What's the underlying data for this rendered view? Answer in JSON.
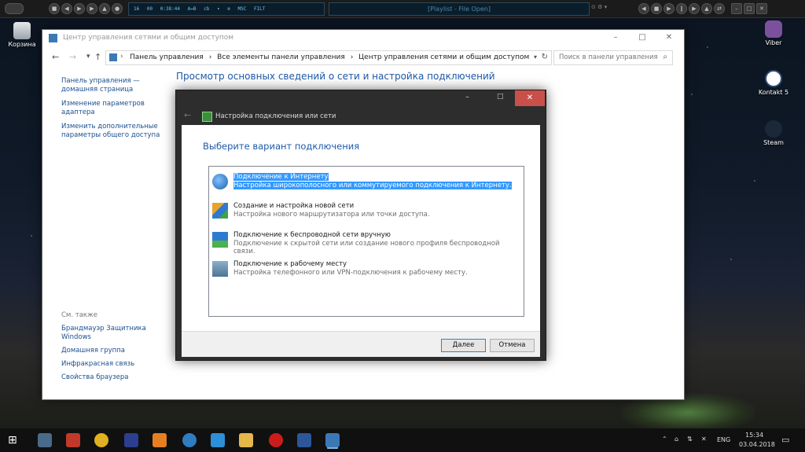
{
  "player": {
    "lcd": [
      "16",
      "00",
      "0:38:44",
      "A↔B",
      "cb",
      "▾",
      "⊕",
      "MSC",
      "FILT"
    ],
    "title": "[Playlist - File Open]"
  },
  "desktop": {
    "icons": [
      {
        "label": "Корзина"
      },
      {
        "label": "Viber"
      },
      {
        "label": "Kontakt 5"
      },
      {
        "label": "Steam"
      }
    ]
  },
  "window": {
    "title": "Центр управления сетями и общим доступом",
    "breadcrumbs": [
      "Панель управления",
      "›",
      "Все элементы панели управления",
      "›",
      "Центр управления сетями и общим доступом"
    ],
    "search_placeholder": "Поиск в панели управления",
    "left_links": [
      "Панель управления — домашняя страница",
      "Изменение параметров адаптера",
      "Изменить дополнительные параметры общего доступа"
    ],
    "see_also_header": "См. также",
    "see_also_links": [
      "Брандмауэр Защитника Windows",
      "Домашняя группа",
      "Инфракрасная связь",
      "Свойства браузера"
    ],
    "heading": "Просмотр основных сведений о сети и настройка подключений"
  },
  "dialog": {
    "title": "Настройка подключения или сети",
    "heading": "Выберите вариант подключения",
    "options": [
      {
        "title": "Подключение к Интернету",
        "desc": "Настройка широкополосного или коммутируемого подключения к Интернету.",
        "selected": true
      },
      {
        "title": "Создание и настройка новой сети",
        "desc": "Настройка нового маршрутизатора или точки доступа."
      },
      {
        "title": "Подключение к беспроводной сети вручную",
        "desc": "Подключение к скрытой сети или создание нового профиля беспроводной связи."
      },
      {
        "title": "Подключение к рабочему месту",
        "desc": "Настройка телефонного или VPN-подключения к рабочему месту."
      }
    ],
    "next_label": "Далее",
    "cancel_label": "Отмена"
  },
  "taskbar": {
    "lang": "ENG",
    "time": "15:34",
    "date": "03.04.2018"
  },
  "colors": {
    "link": "#1a4f8f",
    "heading": "#1e5aa8",
    "selection": "#3399ff",
    "close_red": "#c9504a"
  }
}
